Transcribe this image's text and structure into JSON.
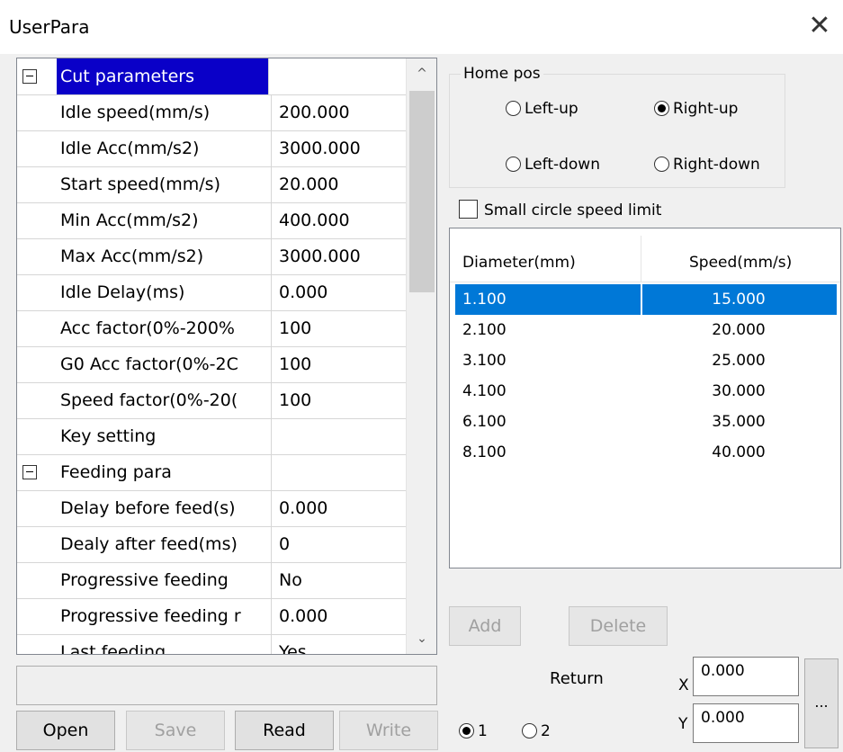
{
  "window": {
    "title": "UserPara",
    "close_glyph": "✕"
  },
  "property_grid": {
    "rows": [
      {
        "kind": "category",
        "name": "Cut parameters",
        "value": "",
        "selected": true
      },
      {
        "kind": "prop",
        "name": "Idle speed(mm/s)",
        "value": "200.000"
      },
      {
        "kind": "prop",
        "name": "Idle Acc(mm/s2)",
        "value": "3000.000"
      },
      {
        "kind": "prop",
        "name": "Start speed(mm/s)",
        "value": "20.000"
      },
      {
        "kind": "prop",
        "name": "Min Acc(mm/s2)",
        "value": "400.000"
      },
      {
        "kind": "prop",
        "name": "Max Acc(mm/s2)",
        "value": "3000.000"
      },
      {
        "kind": "prop",
        "name": "Idle Delay(ms)",
        "value": "0.000"
      },
      {
        "kind": "prop",
        "name": "Acc factor(0%-200%",
        "value": "100"
      },
      {
        "kind": "prop",
        "name": "G0 Acc factor(0%-2C",
        "value": "100"
      },
      {
        "kind": "prop",
        "name": "Speed factor(0%-20(",
        "value": "100"
      },
      {
        "kind": "prop",
        "name": "Key setting",
        "value": ""
      },
      {
        "kind": "category",
        "name": "Feeding para",
        "value": ""
      },
      {
        "kind": "prop",
        "name": "Delay before feed(s)",
        "value": "0.000"
      },
      {
        "kind": "prop",
        "name": "Dealy after feed(ms)",
        "value": "0"
      },
      {
        "kind": "prop",
        "name": "Progressive feeding",
        "value": "No"
      },
      {
        "kind": "prop",
        "name": "Progressive feeding r",
        "value": "0.000"
      },
      {
        "kind": "prop",
        "name": "Last feeding",
        "value": "Yes"
      }
    ],
    "scroll_up_glyph": "^",
    "scroll_down_glyph": "⌄"
  },
  "buttons": {
    "open": "Open",
    "save": "Save",
    "read": "Read",
    "write": "Write",
    "add": "Add",
    "delete": "Delete",
    "more": "..."
  },
  "home_pos": {
    "legend": "Home pos",
    "options": {
      "left_up": "Left-up",
      "right_up": "Right-up",
      "left_down": "Left-down",
      "right_down": "Right-down"
    },
    "selected": "right_up"
  },
  "small_circle": {
    "label": "Small circle speed limit",
    "checked": false
  },
  "circle_table": {
    "headers": [
      "Diameter(mm)",
      "Speed(mm/s)"
    ],
    "rows": [
      [
        "1.100",
        "15.000"
      ],
      [
        "2.100",
        "20.000"
      ],
      [
        "3.100",
        "25.000"
      ],
      [
        "4.100",
        "30.000"
      ],
      [
        "6.100",
        "35.000"
      ],
      [
        "8.100",
        "40.000"
      ]
    ],
    "selected_index": 0
  },
  "return_panel": {
    "label": "Return",
    "x_label": "X",
    "x_value": "0.000",
    "y_label": "Y",
    "y_value": "0.000",
    "radio1": "1",
    "radio2": "2",
    "selected": "1"
  }
}
